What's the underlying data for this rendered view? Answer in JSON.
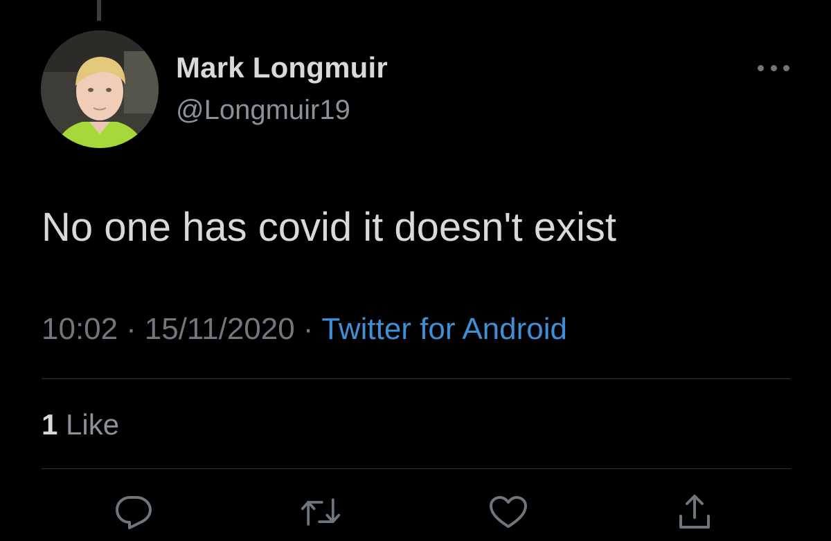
{
  "tweet": {
    "author": {
      "display_name": "Mark Longmuir",
      "handle": "@Longmuir19"
    },
    "text": "No one has covid it doesn't exist",
    "time": "10:02",
    "date": "15/11/2020",
    "separator": "·",
    "source": "Twitter for Android",
    "likes": {
      "count": "1",
      "label": "Like"
    }
  },
  "actions": [
    {
      "name": "reply",
      "icon": "reply-icon"
    },
    {
      "name": "retweet",
      "icon": "retweet-icon"
    },
    {
      "name": "like",
      "icon": "heart-icon"
    },
    {
      "name": "share",
      "icon": "share-icon"
    }
  ],
  "colors": {
    "background": "#000000",
    "primary_text": "#d9d9d9",
    "secondary_text": "#71777d",
    "link": "#3f8fd6",
    "divider": "#2f3336"
  }
}
